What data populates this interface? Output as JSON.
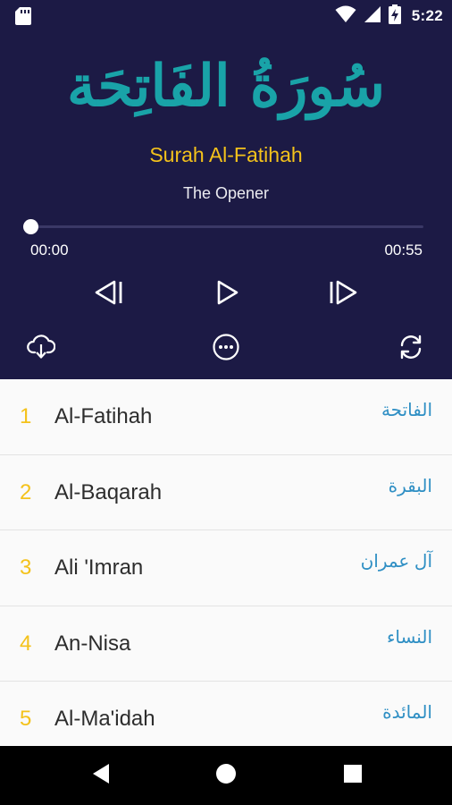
{
  "status_bar": {
    "time": "5:22",
    "icons": [
      "sd-card-icon",
      "wifi-icon",
      "signal-icon",
      "battery-charging-icon"
    ]
  },
  "player": {
    "calligraphy": "سُورَةُ الفَاتِحَة",
    "surah_name": "Surah Al-Fatihah",
    "surah_meaning": "The Opener",
    "elapsed": "00:00",
    "duration": "00:55",
    "progress_fraction": 0.0,
    "controls": [
      "previous-icon",
      "play-icon",
      "next-icon"
    ],
    "actions": [
      "download-icon",
      "more-icon",
      "repeat-icon"
    ]
  },
  "surah_list": [
    {
      "number": "1",
      "name": "Al-Fatihah",
      "arabic": "الفاتحة"
    },
    {
      "number": "2",
      "name": "Al-Baqarah",
      "arabic": "البقرة"
    },
    {
      "number": "3",
      "name": "Ali 'Imran",
      "arabic": "آل عمران"
    },
    {
      "number": "4",
      "name": "An-Nisa",
      "arabic": "النساء"
    },
    {
      "number": "5",
      "name": "Al-Ma'idah",
      "arabic": "المائدة"
    }
  ],
  "nav_bar": [
    "back-icon",
    "home-icon",
    "recents-icon"
  ],
  "colors": {
    "player_background": "#1c1a45",
    "accent_gold": "#f4c21b",
    "calligraphy_teal": "#19a3a8",
    "arabic_text_blue": "#2f8fc4"
  }
}
